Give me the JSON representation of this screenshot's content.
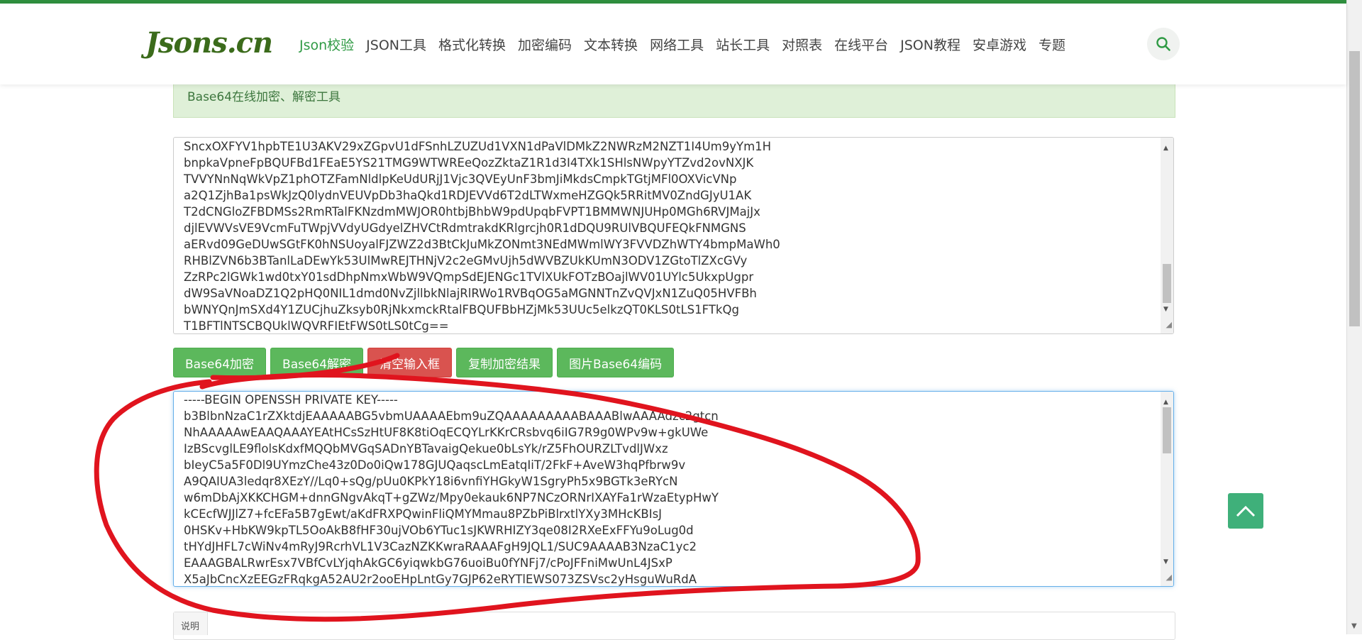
{
  "header": {
    "logo": "Jsons.cn",
    "nav": [
      "Json校验",
      "JSON工具",
      "格式化转换",
      "加密编码",
      "文本转换",
      "网络工具",
      "站长工具",
      "对照表",
      "在线平台",
      "JSON教程",
      "安卓游戏",
      "专题"
    ],
    "active_nav_index": 0,
    "search_icon": "search-icon"
  },
  "notice": {
    "text": "Base64在线加密、解密工具"
  },
  "input_textarea": {
    "lines": [
      "SncxOXFYV1hpbTE1U3AKV29xZGpvU1dFSnhLZUZUd1VXN1dPaVlDMkZ2NWRzM2NZT1I4Um9yYm1H",
      "bnpkaVpneFpBQUFBd1FEaE5YS21TMG9WTWREeQozZktaZ1R1d3I4TXk1SHlsNWpyYTZvd2ovNXJK",
      "TVVYNnNqWkVpZ1phOTZFamNldlpKeUdURjJ1Vjc3QVEyUnF3bmJiMkdsCmpkTGtjMFl0OXVicVNp",
      "a2Q1ZjhBa1psWkJzQ0lydnVEUVpDb3haQkd1RDJEVVd6T2dLTWxmeHZGQk5RRitMV0ZndGJyU1AK",
      "T2dCNGloZFBDMSs2RmRTalFKNzdmMWJOR0htbjBhbW9pdUpqbFVPT1BMMWNJUHp0MGh6RVJMajJx",
      "djlEVWVsVE9VcmFuTWpjVVdyUGdyelZHVCtRdmtrakdKRlgrcjh0R1dDQU9RUlVBQUFEQkFNMGNS",
      "aERvd09GeDUwSGtFK0hNSUoyalFJZWZ2d3BtCkJuMkZONmt3NEdMWmlWY3FVVDZhWTY4bmpMaWh0",
      "RHBlZVN6b3BTanlLaDEwYk53UlMwREJTHNjV2c2eGMvUjh5dWVBZUkKUmN3ODV1ZGtoTlZXcGVy",
      "ZzRPc2lGWk1wd0txY01sdDhpNmxWbW9VQmpSdEJENGc1TVlXUkFOTzBOajlWV01UYlc5UkxpUgpr",
      "dW9SaVNoaDZ1Q2pHQ0NIL1dmd0NvZjllbkNlajRlRWo1RVBqOG5aMGNNTnZvQVJxN1ZuQ05HVFBh",
      "bWNYQnJmSXd4Y1ZUCjhuZksyb0RjNkxmckRtalFBQUFBbHZjMk53UUc5elkzQT0KLS0tLS1FTkQg",
      "T1BFTlNTSCBQUklWQVRFIEtFWS0tLS0tCg=="
    ]
  },
  "buttons": [
    {
      "label": "Base64加密",
      "color": "green"
    },
    {
      "label": "Base64解密",
      "color": "green"
    },
    {
      "label": "清空输入框",
      "color": "red"
    },
    {
      "label": "复制加密结果",
      "color": "green"
    },
    {
      "label": "图片Base64编码",
      "color": "green"
    }
  ],
  "output_textarea": {
    "lines": [
      "-----BEGIN OPENSSH PRIVATE KEY-----",
      "b3BlbnNzaC1rZXktdjEAAAAABG5vbmUAAAAEbm9uZQAAAAAAAAABAAABlwAAAAdzc2gtcn",
      "NhAAAAAwEAAQAAAYEAtHCsSzHtUF8K8tiOqECQYLrKKrCRsbvq6iIG7R9g0WPv9w+gkUWe",
      "IzBScvglLE9flolsKdxfMQQbMVGqSADnYBTavaigQekue0bLsYk/rZ5FhOURZLTvdlJWxz",
      "bIeyC5a5F0Dl9UYmzChe43z0Do0iQw178GJUQaqscLmEatqIiT/2FkF+AveW3hqPfbrw9v",
      "A9QAIUA3ledqr8XEzY//Lq0+sQg/pUu0KPkY18i6vnfiYHGkyW1SgryPh5x9BGTk3eRYcN",
      "w6mDbAjXKKCHGM+dnnGNgvAkqT+gZWz/Mpy0ekauk6NP7NCzORNrIXAYFa1rWzaEtypHwY",
      "kCEcfWJJlZ7+fcEFa5B7gEwt/aKdFRXPQwinFliQMYMmau8PZbPiBlrxtlYXy3MHcKBIsJ",
      "0HSKv+HbKW9kpTL5OoAkB8fHF30ujVOb6YTuc1sJKWRHIZY3qe08I2RXeExFFYu9oLug0d",
      "tHYdJHFL7cWiNv4mRyJ9RcrhVL1V3CazNZKKwraRAAAFgH9JQL1/SUC9AAAAB3NzaC1yc2",
      "EAAAGBALRwrEsx7VBfCvLYjqhAkGC6yiqwkbG76uoiBu0fYNFj7/cPoJFFniMwUnL4JSxP",
      "X5aJbCncXzEEGzFRqkgA52AU2r2ooEHpLntGy7GJP62eRYTlEWS073ZSVsc2yHsguWuRdA"
    ]
  },
  "description_panel": {
    "label": "说明"
  },
  "back_to_top_icon": "chevron-up-icon",
  "colors": {
    "brand_green": "#2f9a44",
    "button_green": "#5cb85c",
    "button_red": "#d9534f",
    "annotation_red": "#e0141e"
  }
}
